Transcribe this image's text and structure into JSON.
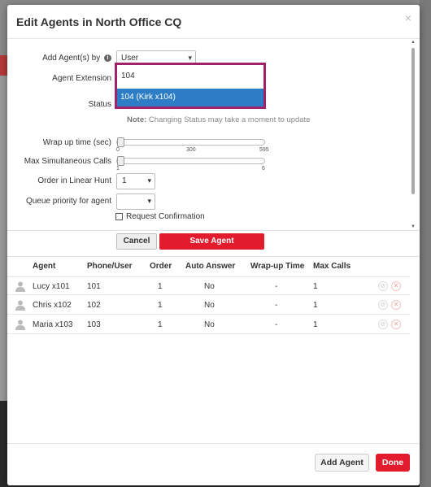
{
  "modal": {
    "title": "Edit Agents in North Office CQ",
    "close": "×"
  },
  "form": {
    "add_by_label": "Add Agent(s) by",
    "add_by_value": "User",
    "info_icon": "i",
    "agent_extension_label": "Agent Extension",
    "agent_extension_value": "104",
    "agent_extension_option": "104 (Kirk x104)",
    "status_label": "Status",
    "note_prefix": "Note:",
    "note_text": " Changing Status may take a moment to update",
    "wrap_up_label": "Wrap up time (sec)",
    "wrap_up_value": 0,
    "wrap_up_ticks": [
      "0",
      "300",
      "595"
    ],
    "max_calls_label": "Max Simultaneous Calls",
    "max_calls_value": 1,
    "max_calls_ticks": [
      "1",
      "6"
    ],
    "order_label": "Order in Linear Hunt",
    "order_value": "1",
    "queue_priority_label": "Queue priority for agent",
    "queue_priority_value": "",
    "request_confirmation_label": "Request Confirmation",
    "request_confirmation_checked": false,
    "cancel_label": "Cancel",
    "save_label": "Save Agent"
  },
  "table": {
    "headers": [
      "Agent",
      "Phone/User",
      "Order",
      "Auto Answer",
      "Wrap-up Time",
      "Max Calls"
    ],
    "rows": [
      {
        "agent": "Lucy x101",
        "phone": "101",
        "order": "1",
        "auto_answer": "No",
        "wrap_up": "-",
        "max_calls": "1"
      },
      {
        "agent": "Chris x102",
        "phone": "102",
        "order": "1",
        "auto_answer": "No",
        "wrap_up": "-",
        "max_calls": "1"
      },
      {
        "agent": "Maria x103",
        "phone": "103",
        "order": "1",
        "auto_answer": "No",
        "wrap_up": "-",
        "max_calls": "1"
      }
    ]
  },
  "footer": {
    "add_agent_label": "Add Agent",
    "done_label": "Done"
  },
  "icons": {
    "user": "user-icon",
    "edit": "edit-icon",
    "delete": "delete-icon",
    "caret": "▾"
  },
  "colors": {
    "primary_red": "#e31c2d",
    "highlight_blue": "#2c7dc5",
    "focus_border": "#a0226b"
  }
}
